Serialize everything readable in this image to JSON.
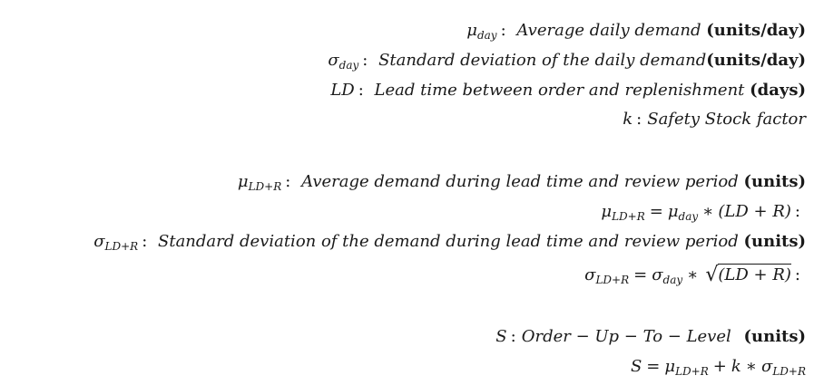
{
  "definitions": [
    {
      "symbol": "μ",
      "subscript": "day",
      "description": "Average daily demand",
      "unit": "(units/day)"
    },
    {
      "symbol": "σ",
      "subscript": "day",
      "description": "Standard deviation of the daily demand",
      "unit": "(units/day)"
    },
    {
      "symbol": "LD",
      "subscript": "",
      "description": "Lead time between order and replenishment",
      "unit": "(days)"
    },
    {
      "symbol": "k",
      "subscript": "",
      "description": "Safety Stock factor",
      "unit": ""
    }
  ],
  "mu_ld_r": {
    "symbol": "μ",
    "subscript": "LD+R",
    "description": "Average demand during lead time and review period",
    "unit": "(units)",
    "formula_sub_day": "day",
    "formula_tail": "(LD + R)"
  },
  "sigma_ld_r": {
    "symbol": "σ",
    "subscript": "LD+R",
    "description": "Standard deviation of the demand during lead time and review period",
    "unit": "(units)",
    "formula_sub_day": "day",
    "formula_radicand": "(LD + R)"
  },
  "order_up_to": {
    "symbol": "S",
    "description": "Order − Up − To − Level",
    "unit": "(units)",
    "formula_mu": "μ",
    "formula_mu_sub": "LD+R",
    "formula_k": "k",
    "formula_sigma": "σ",
    "formula_sigma_sub": "LD+R"
  },
  "colon": ":",
  "equals": "=",
  "times": "∗",
  "plus": "+"
}
